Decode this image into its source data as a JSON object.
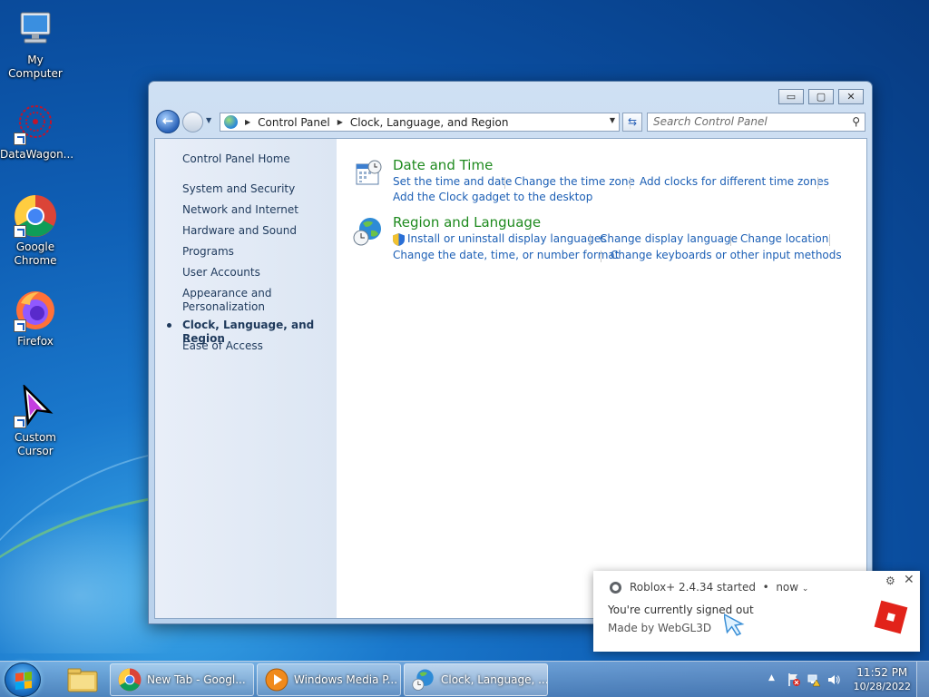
{
  "desktop": {
    "icons": [
      {
        "label": "My Computer",
        "icon": "computer-icon"
      },
      {
        "label": "DataWagon...",
        "icon": "datawagon-icon"
      },
      {
        "label": "Google Chrome",
        "icon": "chrome-icon"
      },
      {
        "label": "Firefox",
        "icon": "firefox-icon"
      },
      {
        "label": "Custom Cursor",
        "icon": "cursor-app-icon"
      }
    ]
  },
  "window": {
    "title": "Clock, Language, and Region",
    "controls": {
      "minimize": "▭",
      "maximize": "▢",
      "close": "✕"
    },
    "breadcrumb": [
      "Control Panel",
      "Clock, Language, and Region"
    ],
    "search_placeholder": "Search Control Panel",
    "left_pane": [
      {
        "label": "Control Panel Home",
        "active": false
      },
      {
        "label": "System and Security",
        "active": false
      },
      {
        "label": "Network and Internet",
        "active": false
      },
      {
        "label": "Hardware and Sound",
        "active": false
      },
      {
        "label": "Programs",
        "active": false
      },
      {
        "label": "User Accounts",
        "active": false
      },
      {
        "label": "Appearance and Personalization",
        "active": false
      },
      {
        "label": "Clock, Language, and Region",
        "active": true
      },
      {
        "label": "Ease of Access",
        "active": false
      }
    ],
    "categories": [
      {
        "title": "Date and Time",
        "icon": "calendar-clock-icon",
        "links": [
          "Set the time and date",
          "Change the time zone",
          "Add clocks for different time zones",
          "Add the Clock gadget to the desktop"
        ]
      },
      {
        "title": "Region and Language",
        "icon": "globe-clock-icon",
        "links": [
          "Install or uninstall display languages",
          "Change display language",
          "Change location",
          "Change the date, time, or number format",
          "Change keyboards or other input methods"
        ]
      }
    ]
  },
  "notification": {
    "app_line": "Roblox+ 2.4.34 started",
    "time": "now",
    "message": "You're currently signed out",
    "sub": "Made by WebGL3D"
  },
  "taskbar": {
    "buttons": [
      {
        "label": "New Tab - Googl...",
        "icon": "chrome-icon",
        "active": false
      },
      {
        "label": "Windows Media P...",
        "icon": "media-player-icon",
        "active": false
      },
      {
        "label": "Clock, Language, ...",
        "icon": "control-panel-icon",
        "active": true
      }
    ],
    "clock_time": "11:52 PM",
    "clock_date": "10/28/2022"
  }
}
